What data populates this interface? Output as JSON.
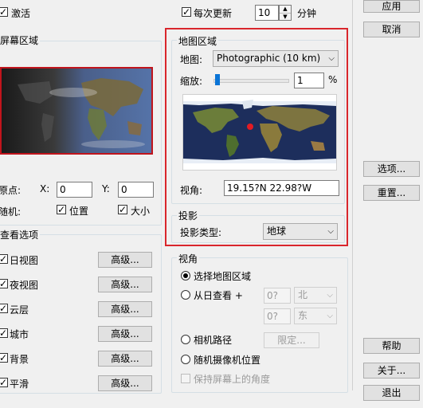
{
  "top": {
    "activate_label": "激活",
    "update_every_label": "每次更新",
    "update_value": "10",
    "minutes_label": "分钟"
  },
  "right_buttons": {
    "apply": "应用",
    "cancel": "取消",
    "options": "选项...",
    "reset": "重置...",
    "help": "帮助",
    "about": "关于...",
    "exit": "退出"
  },
  "screen_area": {
    "title": "屏幕区域",
    "origin_label": "原点:",
    "x_label": "X:",
    "x_value": "0",
    "y_label": "Y:",
    "y_value": "0",
    "random_label": "随机:",
    "position_label": "位置",
    "size_label": "大小"
  },
  "view_options": {
    "title": "查看选项",
    "more_label": "高级...",
    "items": [
      {
        "label": "日视图"
      },
      {
        "label": "夜视图"
      },
      {
        "label": "云层"
      },
      {
        "label": "城市"
      },
      {
        "label": "背景"
      },
      {
        "label": "平滑"
      }
    ]
  },
  "map_area": {
    "title": "地图区域",
    "map_label": "地图:",
    "map_value": "Photographic (10 km)",
    "zoom_label": "缩放:",
    "zoom_value": "1",
    "zoom_unit": "%",
    "zoom_level": 0.02,
    "view_angle_label": "视角:",
    "view_angle_value": "19.15?N   22.98?W"
  },
  "projection": {
    "title": "投影",
    "type_label": "投影类型:",
    "type_value": "地球"
  },
  "view": {
    "title": "视角",
    "select_map_area": "选择地图区域",
    "from_sun": "从日查看 +",
    "lat_value": "0?",
    "lat_dir": "北",
    "lon_value": "0?",
    "lon_dir": "东",
    "camera_path": "相机路径",
    "fixed_button": "限定...",
    "random_camera": "随机摄像机位置",
    "keep_angle": "保持屏幕上的角度"
  },
  "colors": {
    "highlight_border": "#d9262c",
    "map_ocean": "#1d2e5c"
  }
}
